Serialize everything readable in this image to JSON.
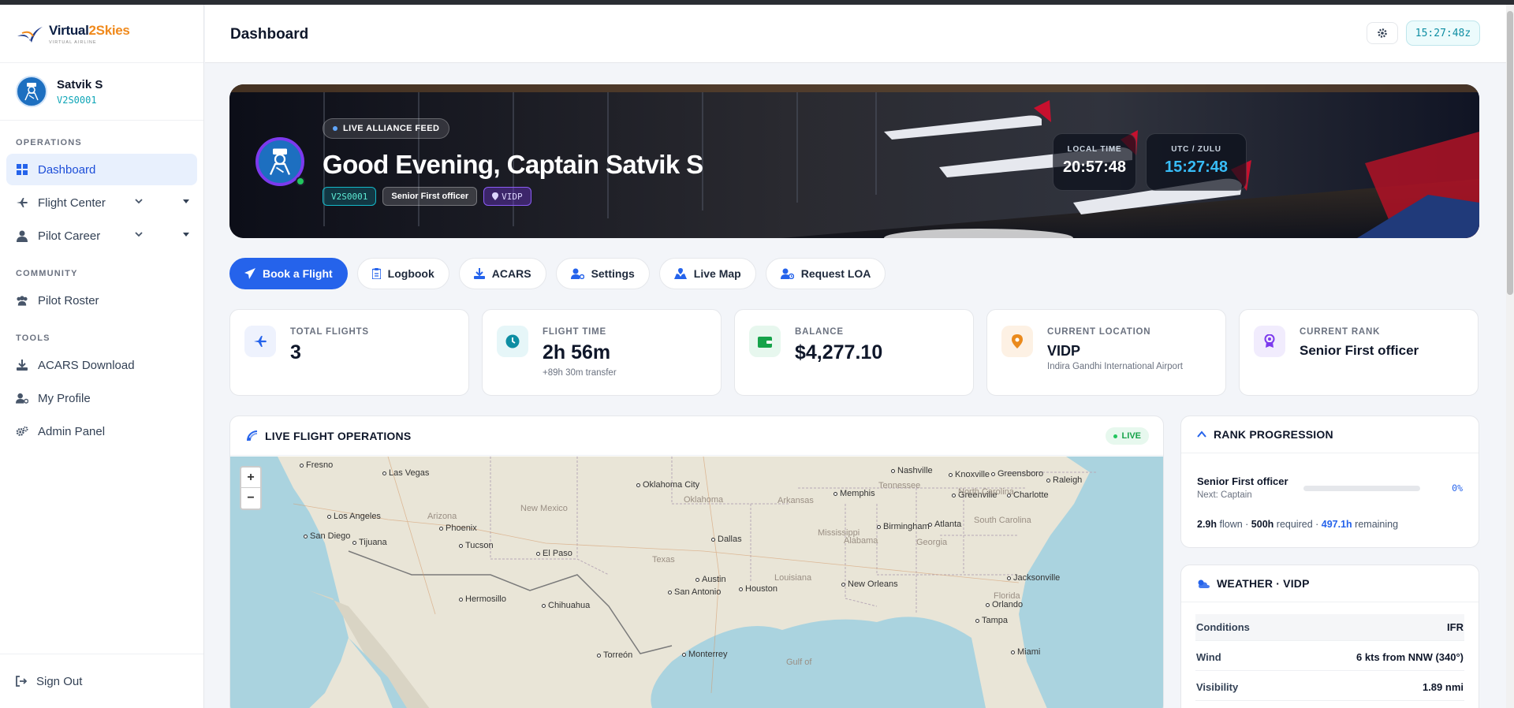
{
  "brand": {
    "name_a": "Virtual",
    "name_b": "2Skies",
    "sub": "VIRTUAL AIRLINE"
  },
  "user": {
    "name": "Satvik S",
    "code": "V2S0001"
  },
  "sidebar": {
    "operations_label": "OPERATIONS",
    "dashboard": "Dashboard",
    "flight_center": "Flight Center",
    "pilot_career": "Pilot Career",
    "community_label": "COMMUNITY",
    "pilot_roster": "Pilot Roster",
    "tools_label": "TOOLS",
    "acars_download": "ACARS Download",
    "my_profile": "My Profile",
    "admin_panel": "Admin Panel",
    "sign_out": "Sign Out"
  },
  "header": {
    "title": "Dashboard",
    "utc_clock": "15:27:48z"
  },
  "hero": {
    "feed_badge": "LIVE ALLIANCE FEED",
    "greeting": "Good Evening, Captain Satvik S",
    "chip_code": "V2S0001",
    "chip_rank": "Senior First officer",
    "chip_location": "VIDP",
    "local_time_label": "LOCAL TIME",
    "local_time": "20:57:48",
    "utc_label": "UTC / ZULU",
    "utc_time": "15:27:48"
  },
  "quick_actions": {
    "book": "Book a Flight",
    "logbook": "Logbook",
    "acars": "ACARS",
    "settings": "Settings",
    "live_map": "Live Map",
    "request_loa": "Request LOA"
  },
  "stats": {
    "total_flights": {
      "label": "TOTAL FLIGHTS",
      "value": "3"
    },
    "flight_time": {
      "label": "FLIGHT TIME",
      "value": "2h 56m",
      "sub": "+89h 30m transfer"
    },
    "balance": {
      "label": "BALANCE",
      "value": "$4,277.10"
    },
    "location": {
      "label": "CURRENT LOCATION",
      "value": "VIDP",
      "sub": "Indira Gandhi International Airport"
    },
    "rank": {
      "label": "CURRENT RANK",
      "value": "Senior First officer"
    }
  },
  "live_ops": {
    "title": "LIVE FLIGHT OPERATIONS",
    "badge": "LIVE",
    "zoom_in": "+",
    "zoom_out": "−",
    "cities": [
      "Fresno",
      "Las Vegas",
      "Los Angeles",
      "San Diego",
      "Tijuana",
      "Phoenix",
      "Tucson",
      "El Paso",
      "Oklahoma City",
      "Dallas",
      "Austin",
      "San Antonio",
      "Houston",
      "Memphis",
      "Nashville",
      "Knoxville",
      "Greensboro",
      "Raleigh",
      "Greenville",
      "Charlotte",
      "Birmingham",
      "Atlanta",
      "New Orleans",
      "Jacksonville",
      "Orlando",
      "Tampa",
      "Miami",
      "Hermosillo",
      "Chihuahua",
      "Torreón",
      "Monterrey"
    ],
    "regions": [
      "Arizona",
      "New Mexico",
      "Oklahoma",
      "Arkansas",
      "Tennessee",
      "North Carolina",
      "South Carolina",
      "Texas",
      "Louisiana",
      "Mississippi",
      "Alabama",
      "Georgia",
      "Florida",
      "Gulf of"
    ]
  },
  "rank_progression": {
    "title": "RANK PROGRESSION",
    "current": "Senior First officer",
    "next": "Next: Captain",
    "percent": "0%",
    "progress_fraction": 0,
    "flown": "2.9h",
    "flown_label": "flown",
    "required": "500h",
    "required_label": "required",
    "remaining": "497.1h",
    "remaining_label": "remaining"
  },
  "weather": {
    "title": "WEATHER · VIDP",
    "rows": [
      {
        "k": "Conditions",
        "v": "IFR"
      },
      {
        "k": "Wind",
        "v": "6 kts from NNW (340°)"
      },
      {
        "k": "Visibility",
        "v": "1.89 nmi"
      }
    ]
  },
  "colors": {
    "accent": "#2563eb",
    "teal": "#0ea5b7",
    "purple": "#7c3aed",
    "live_green": "#22c55e"
  }
}
